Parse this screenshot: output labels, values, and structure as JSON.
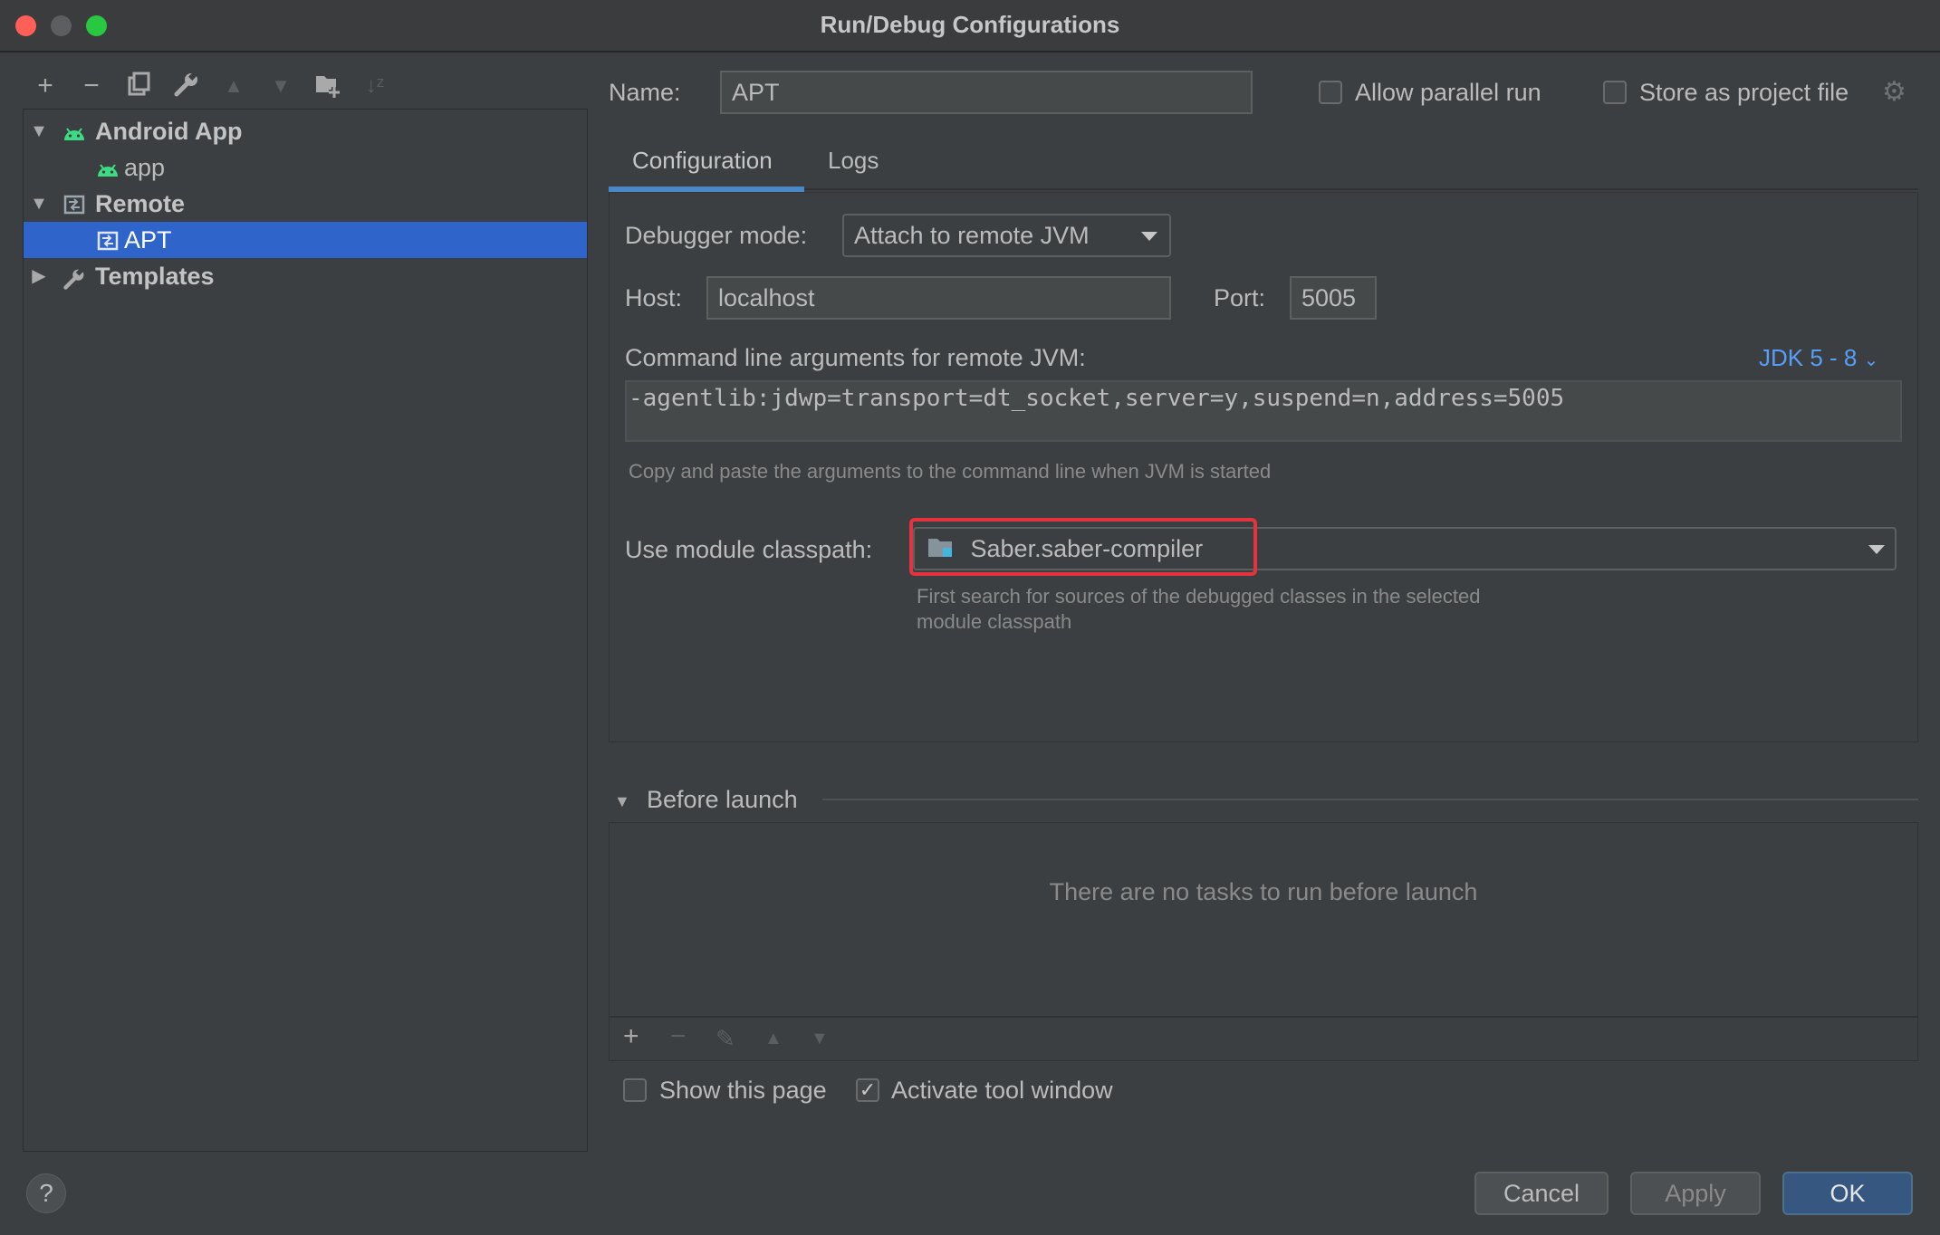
{
  "window": {
    "title": "Run/Debug Configurations"
  },
  "tree": {
    "items": [
      {
        "label": "Android App",
        "bold": true
      },
      {
        "label": "app"
      },
      {
        "label": "Remote",
        "bold": true
      },
      {
        "label": "APT",
        "selected": true
      },
      {
        "label": "Templates",
        "bold": true
      }
    ]
  },
  "header": {
    "name_label": "Name:",
    "name_value": "APT",
    "allow_parallel_label": "Allow parallel run",
    "allow_parallel_checked": false,
    "store_project_label": "Store as project file",
    "store_project_checked": false
  },
  "tabs": [
    {
      "label": "Configuration",
      "active": true
    },
    {
      "label": "Logs",
      "active": false
    }
  ],
  "config": {
    "debugger_mode_label": "Debugger mode:",
    "debugger_mode_value": "Attach to remote JVM",
    "host_label": "Host:",
    "host_value": "localhost",
    "port_label": "Port:",
    "port_value": "5005",
    "cmdline_label": "Command line arguments for remote JVM:",
    "jdk_label": "JDK 5 - 8",
    "cmdline_value": "-agentlib:jdwp=transport=dt_socket,server=y,suspend=n,address=5005",
    "cmdline_hint": "Copy and paste the arguments to the command line when JVM is started",
    "classpath_label": "Use module classpath:",
    "classpath_value": "Saber.saber-compiler",
    "classpath_hint_1": "First search for sources of the debugged classes in the selected",
    "classpath_hint_2": "module classpath"
  },
  "before_launch": {
    "title": "Before launch",
    "empty_text": "There are no tasks to run before launch"
  },
  "options": {
    "show_page_label": "Show this page",
    "show_page_checked": false,
    "activate_tool_label": "Activate tool window",
    "activate_tool_checked": true,
    "check_glyph": "✓"
  },
  "buttons": {
    "help": "?",
    "cancel": "Cancel",
    "apply": "Apply",
    "ok": "OK"
  },
  "colors": {
    "selection": "#2f65ca",
    "accent_link": "#589df6",
    "highlight_box": "#e5323f",
    "android_green": "#3ddc84"
  }
}
